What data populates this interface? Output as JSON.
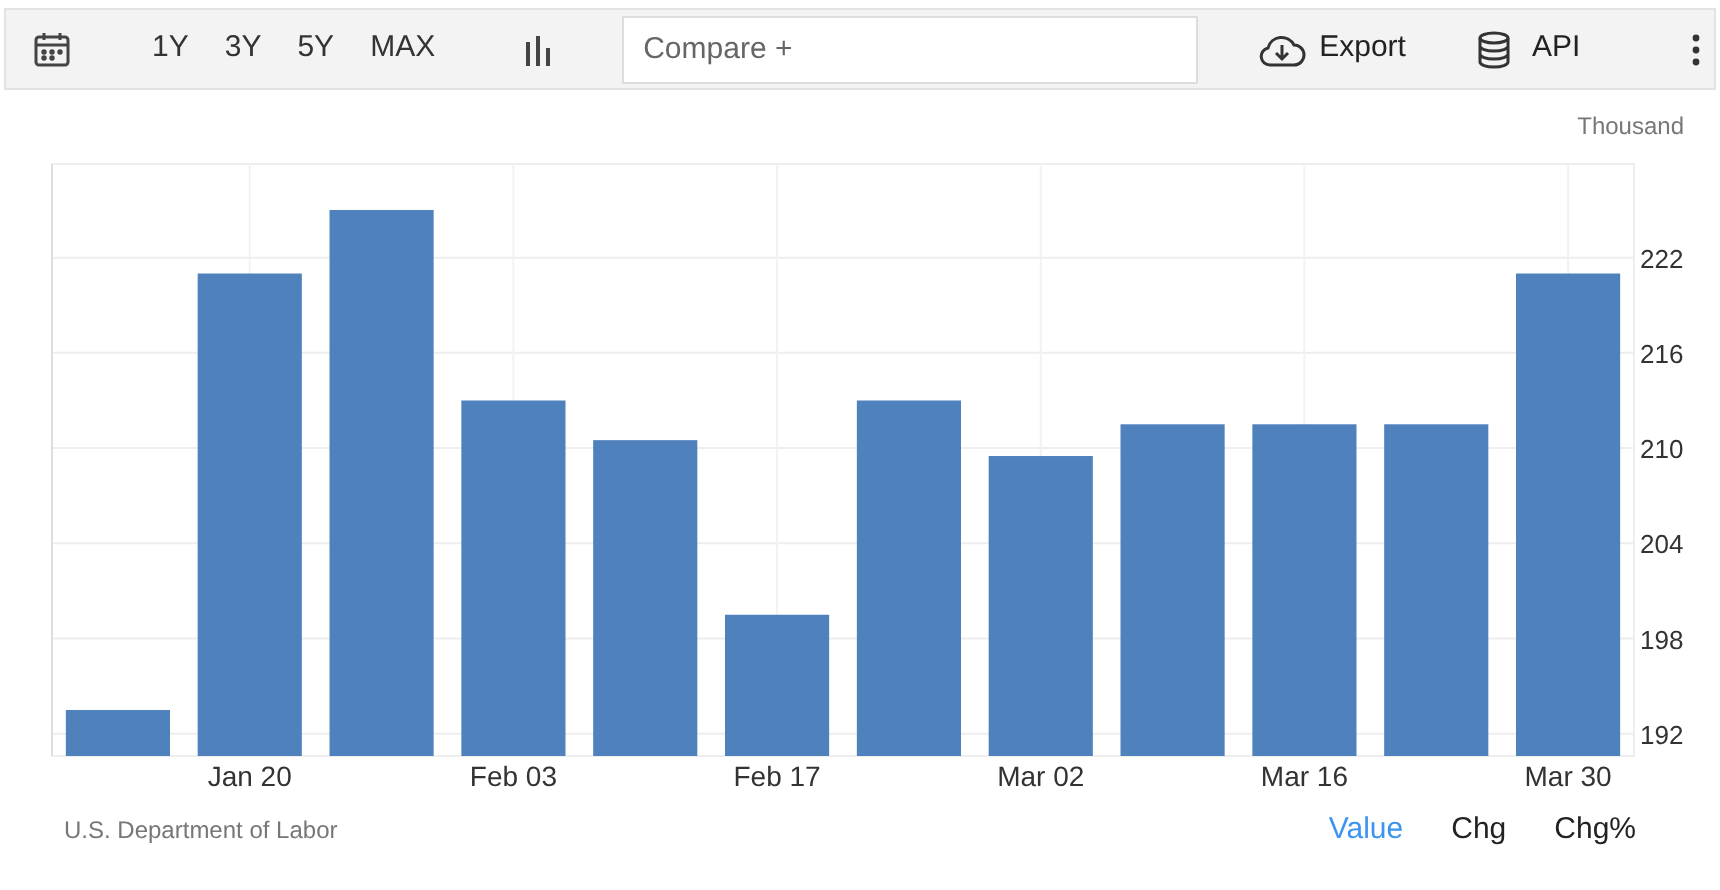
{
  "toolbar": {
    "ranges": [
      {
        "label": "1Y",
        "selected": false
      },
      {
        "label": "3Y",
        "selected": false
      },
      {
        "label": "5Y",
        "selected": false
      },
      {
        "label": "MAX",
        "selected": false
      }
    ],
    "compare": {
      "placeholder": "Compare +"
    },
    "export": "Export",
    "api": "API"
  },
  "chart": {
    "chart_data": {
      "type": "bar",
      "ylabel": "Thousand",
      "grid": true,
      "categories": [
        null,
        "Jan 20",
        null,
        "Feb 03",
        null,
        "Feb 17",
        null,
        "Mar 02",
        null,
        "Mar 16",
        null,
        "Mar 30"
      ],
      "values": [
        193.5,
        221,
        225,
        213,
        210.5,
        199.5,
        213,
        209.5,
        211.5,
        211.5,
        211.5,
        221
      ],
      "ylim": [
        190.6,
        227.9
      ],
      "yticks": [
        192,
        198,
        204,
        210,
        216,
        222
      ]
    }
  },
  "footer": {
    "source": "U.S. Department of Labor",
    "modes": [
      {
        "label": "Value",
        "selected": true
      },
      {
        "label": "Chg",
        "selected": false
      },
      {
        "label": "Chg%",
        "selected": false
      }
    ]
  }
}
